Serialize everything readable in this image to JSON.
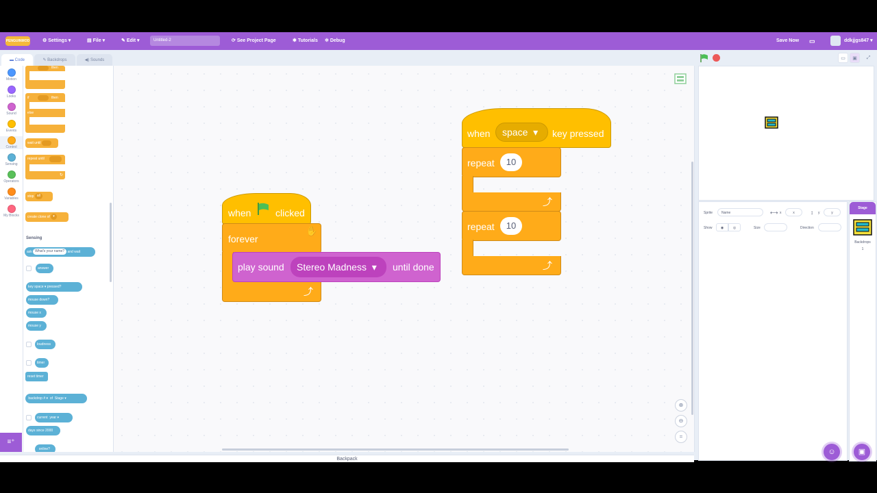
{
  "menubar": {
    "logo": "PENGUINMOD",
    "settings": "Settings",
    "file": "File",
    "edit": "Edit",
    "project_title": "Untitled-2",
    "see_project_page": "See Project Page",
    "tutorials": "Tutorials",
    "debug": "Debug",
    "save_now": "Save Now",
    "username": "ddkjjgs847"
  },
  "tabs": {
    "code": "Code",
    "backdrops": "Backdrops",
    "sounds": "Sounds"
  },
  "categories": [
    {
      "label": "Motion",
      "color": "#4c97ff"
    },
    {
      "label": "Looks",
      "color": "#9966ff"
    },
    {
      "label": "Sound",
      "color": "#cf63cf"
    },
    {
      "label": "Events",
      "color": "#ffbf00"
    },
    {
      "label": "Control",
      "color": "#ffab19"
    },
    {
      "label": "Sensing",
      "color": "#5cb1d6"
    },
    {
      "label": "Operators",
      "color": "#59c059"
    },
    {
      "label": "Variables",
      "color": "#ff8c1a"
    },
    {
      "label": "My Blocks",
      "color": "#ff6680"
    }
  ],
  "palette": {
    "then1": "then",
    "if_label": "if",
    "then2": "then",
    "else_label": "else",
    "wait_until": "wait until",
    "repeat_until": "repeat until",
    "stop": "stop",
    "stop_value": "all",
    "create_clone": "create clone of",
    "sensing_header": "Sensing",
    "ask": "ask",
    "ask_value": "What's your name?",
    "and_wait": "and wait",
    "answer": "answer",
    "key_label": "key",
    "key_value": "space",
    "pressed": "pressed?",
    "mouse_down": "mouse down?",
    "mouse_x": "mouse x",
    "mouse_y": "mouse y",
    "loudness": "loudness",
    "timer": "timer",
    "reset_timer": "reset timer",
    "backdrop_num": "backdrop #",
    "of_label": "of",
    "stage_value": "Stage",
    "current": "current",
    "year": "year",
    "days_since": "days since 2000",
    "online": "online?"
  },
  "script1": {
    "when": "when",
    "clicked": "clicked",
    "forever": "forever",
    "play_sound": "play sound",
    "sound_name": "Stereo Madness",
    "until_done": "until done"
  },
  "script2": {
    "when": "when",
    "key": "space",
    "key_pressed": "key pressed",
    "repeat1": "repeat",
    "count1": "10",
    "repeat2": "repeat",
    "count2": "10"
  },
  "sprite_info": {
    "sprite_label": "Sprite",
    "name_placeholder": "Name",
    "x_label": "x",
    "x_placeholder": "x",
    "y_label": "y",
    "y_placeholder": "y",
    "show_label": "Show",
    "size_label": "Size",
    "direction_label": "Direction"
  },
  "stage_col": {
    "stage": "Stage",
    "backdrops": "Backdrops",
    "count": "1"
  },
  "backpack": "Backpack",
  "colors": {
    "menubar": "#9d5cd6",
    "control": "#ffab19",
    "events": "#ffbf00",
    "sound": "#cf63cf",
    "sensing": "#5cb1d6"
  }
}
